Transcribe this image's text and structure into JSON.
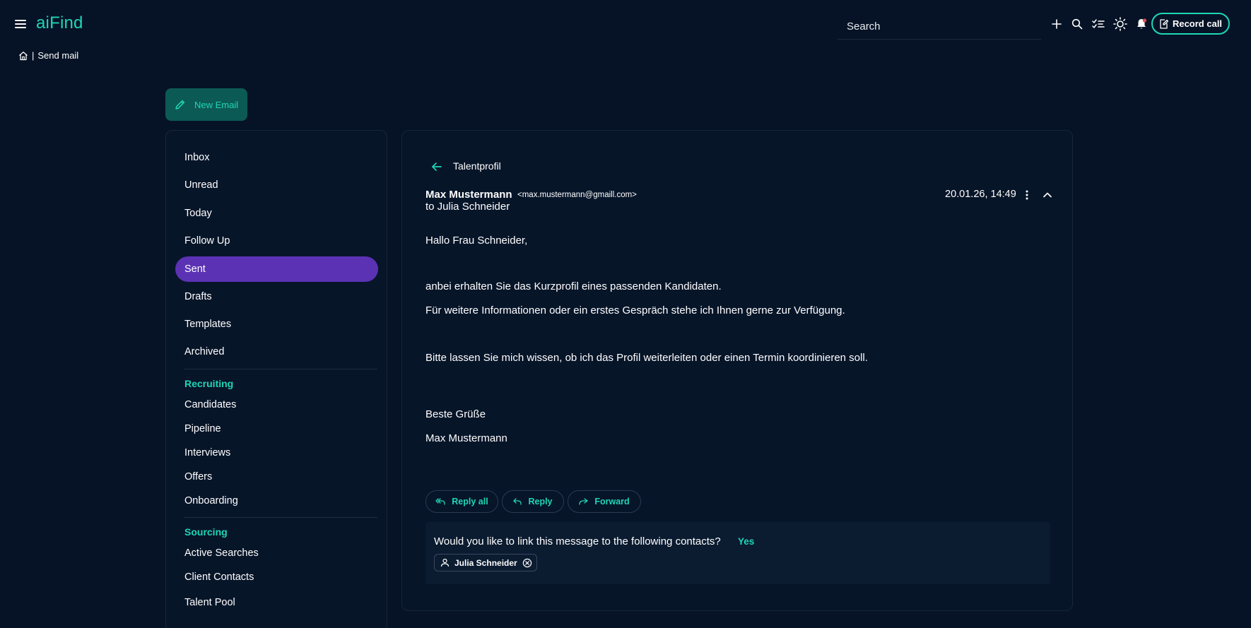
{
  "app": {
    "logo": "aiFind",
    "search_placeholder": "Search",
    "record_call_label": "Record call",
    "accent_color": "#1fd6b6",
    "active_nav_color": "#5b32b4",
    "background_color": "#061326"
  },
  "icons": {
    "menu": "menu-icon",
    "add": "plus-icon",
    "search": "search-icon",
    "tasks": "checklist-icon",
    "theme": "sun-icon",
    "notifications": "bell-icon",
    "record": "edit-document-icon",
    "home": "home-icon",
    "new_email": "pencil-icon",
    "back": "arrow-left-icon",
    "more": "more-vertical-icon",
    "collapse": "chevron-up-icon",
    "reply_all": "reply-all-icon",
    "reply": "reply-icon",
    "forward": "forward-icon",
    "contact": "person-icon",
    "remove": "close-circle-icon"
  },
  "breadcrumb": {
    "separator": "|",
    "current": "Send mail"
  },
  "new_email_label": "New Email",
  "sidebar": {
    "mail_items": [
      {
        "label": "Inbox"
      },
      {
        "label": "Unread"
      },
      {
        "label": "Today"
      },
      {
        "label": "Follow Up"
      },
      {
        "label": "Sent",
        "active": true
      },
      {
        "label": "Drafts"
      },
      {
        "label": "Templates"
      },
      {
        "label": "Archived"
      }
    ],
    "recruiting": {
      "heading": "Recruiting",
      "items": [
        {
          "label": "Candidates"
        },
        {
          "label": "Pipeline"
        },
        {
          "label": "Interviews"
        },
        {
          "label": "Offers"
        },
        {
          "label": "Onboarding"
        }
      ]
    },
    "sourcing": {
      "heading": "Sourcing",
      "items": [
        {
          "label": "Active Searches"
        },
        {
          "label": "Client Contacts"
        },
        {
          "label": "Talent Pool"
        }
      ]
    }
  },
  "message": {
    "subject": "Talentprofil",
    "sender_name": "Max Mustermann",
    "sender_email": "<max.mustermann@gmaill.com>",
    "recipient_line": "to Julia Schneider",
    "timestamp": "20.01.26, 14:49",
    "body": [
      "Hallo Frau Schneider,",
      "anbei erhalten Sie das Kurzprofil eines passenden Kandidaten.",
      "Für weitere Informationen oder ein erstes Gespräch stehe ich Ihnen gerne zur Verfügung.",
      "Bitte lassen Sie mich wissen, ob ich das Profil weiterleiten oder einen Termin koordinieren soll.",
      "Beste Grüße",
      "Max Mustermann"
    ]
  },
  "actions": {
    "reply_all": "Reply all",
    "reply": "Reply",
    "forward": "Forward"
  },
  "link_prompt": {
    "question": "Would you like to link this message to the following contacts?",
    "yes": "Yes",
    "contact": "Julia Schneider"
  }
}
